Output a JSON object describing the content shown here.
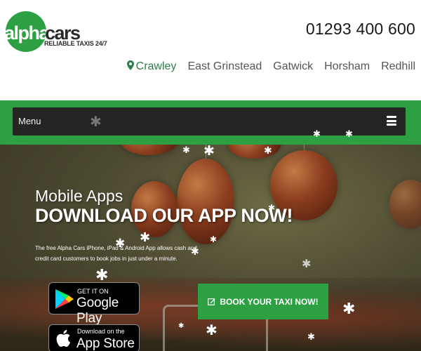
{
  "brand": {
    "logo_alpha": "alpha",
    "logo_cars": "cars",
    "tagline": "RELIABLE TAXIS 24/7"
  },
  "header": {
    "phone": "01293 400 600",
    "locations": [
      {
        "label": "Crawley",
        "active": true,
        "icon": "map-pin-icon"
      },
      {
        "label": "East Grinstead",
        "active": false
      },
      {
        "label": "Gatwick",
        "active": false
      },
      {
        "label": "Horsham",
        "active": false
      },
      {
        "label": "Redhill",
        "active": false
      }
    ]
  },
  "nav": {
    "menu_label": "Menu",
    "menu_icon": "hamburger-icon"
  },
  "hero": {
    "subtitle": "Mobile Apps",
    "title": "DOWNLOAD OUR APP NOW!",
    "description": "The free Alpha Cars iPhone, iPad & Android App allows cash and credit card customers to book jobs in just under a minute.",
    "google_play": {
      "small": "GET IT ON",
      "big": "Google Play",
      "icon": "google-play-icon"
    },
    "app_store": {
      "small": "Download on the",
      "big": "App Store",
      "icon": "apple-icon"
    },
    "book_button": {
      "label": "BOOK YOUR TAXI NOW!",
      "icon": "edit-icon"
    }
  },
  "colors": {
    "brand_green": "#2da044",
    "active_location": "#2e7d4a",
    "menu_bar": "#252525"
  }
}
